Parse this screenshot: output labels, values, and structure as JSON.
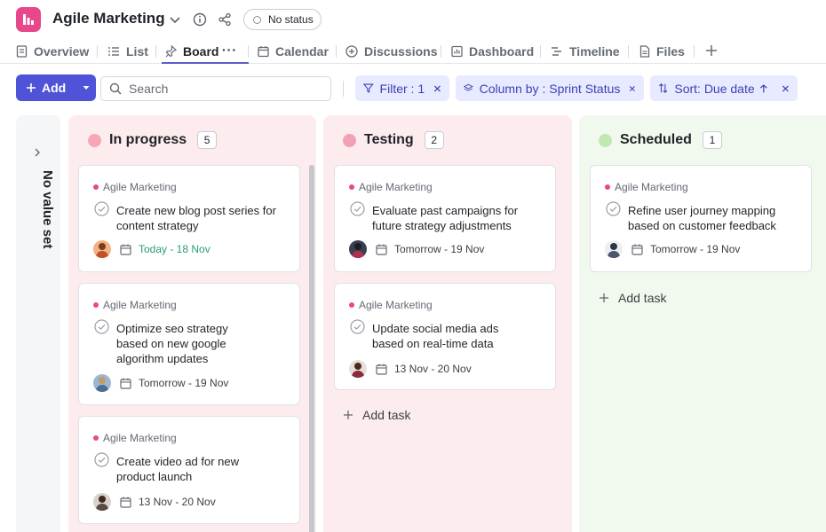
{
  "header": {
    "title": "Agile Marketing",
    "status": "No status",
    "brand_color": "#e8478b"
  },
  "tabs": [
    {
      "label": "Overview",
      "icon": "document-icon"
    },
    {
      "label": "List",
      "icon": "list-icon"
    },
    {
      "label": "Board",
      "icon": "pin-icon",
      "active": true
    },
    {
      "label": "Calendar",
      "icon": "calendar-icon"
    },
    {
      "label": "Discussions",
      "icon": "discussion-icon"
    },
    {
      "label": "Dashboard",
      "icon": "dashboard-icon"
    },
    {
      "label": "Timeline",
      "icon": "timeline-icon"
    },
    {
      "label": "Files",
      "icon": "file-icon"
    }
  ],
  "toolbar": {
    "add_label": "Add",
    "search_placeholder": "Search",
    "filter_label": "Filter : 1",
    "column_by_label": "Column by : Sprint Status",
    "sort_label": "Sort: Due date",
    "accent_color": "#4e53d8"
  },
  "board": {
    "no_value_label": "No value set",
    "add_task_label": "Add task",
    "columns": [
      {
        "title": "In progress",
        "count": "5",
        "color": "#f7a6b8",
        "cards": [
          {
            "project": "Agile Marketing",
            "title": "Create new blog post series for content strategy",
            "date": "Today - 18 Nov",
            "date_color": "#2a9d7a"
          },
          {
            "project": "Agile Marketing",
            "title": "Optimize seo strategy based on new google algorithm updates",
            "date": "Tomorrow - 19 Nov"
          },
          {
            "project": "Agile Marketing",
            "title": "Create video ad for new product launch",
            "date": "13 Nov - 20 Nov"
          }
        ]
      },
      {
        "title": "Testing",
        "count": "2",
        "color": "#f2a0b6",
        "cards": [
          {
            "project": "Agile Marketing",
            "title": "Evaluate past campaigns for future strategy adjustments",
            "date": "Tomorrow - 19 Nov"
          },
          {
            "project": "Agile Marketing",
            "title": "Update social media ads based on real-time data",
            "date": "13 Nov - 20 Nov"
          }
        ]
      },
      {
        "title": "Scheduled",
        "count": "1",
        "color": "#bfe8b3",
        "cards": [
          {
            "project": "Agile Marketing",
            "title": "Refine user journey mapping based on customer feedback",
            "date": "Tomorrow - 19 Nov"
          }
        ]
      }
    ]
  }
}
